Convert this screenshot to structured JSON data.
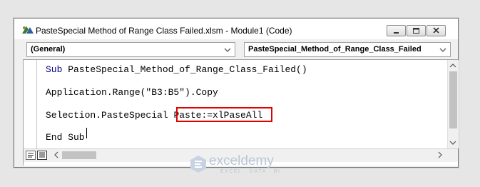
{
  "window": {
    "title": "PasteSpecial Method of Range Class Failed.xlsm - Module1 (Code)"
  },
  "toolbar": {
    "object_dropdown": "(General)",
    "procedure_dropdown": "PasteSpecial_Method_of_Range_Class_Failed"
  },
  "code": {
    "line1_kw": "Sub",
    "line1_rest": " PasteSpecial_Method_of_Range_Class_Failed()",
    "line2": "Application.Range(\"B3:B5\").Copy",
    "line3_pre": "Selection.PasteSpecial ",
    "line3_highlight": "Paste:=xlPaseAll",
    "line4": "End Sub"
  },
  "watermark": {
    "name": "exceldemy",
    "tagline": "EXCEL · DATA · BI"
  },
  "colors": {
    "keyword": "#00007f",
    "highlight_border": "#e00000",
    "window_bg": "#f0f0f0"
  }
}
